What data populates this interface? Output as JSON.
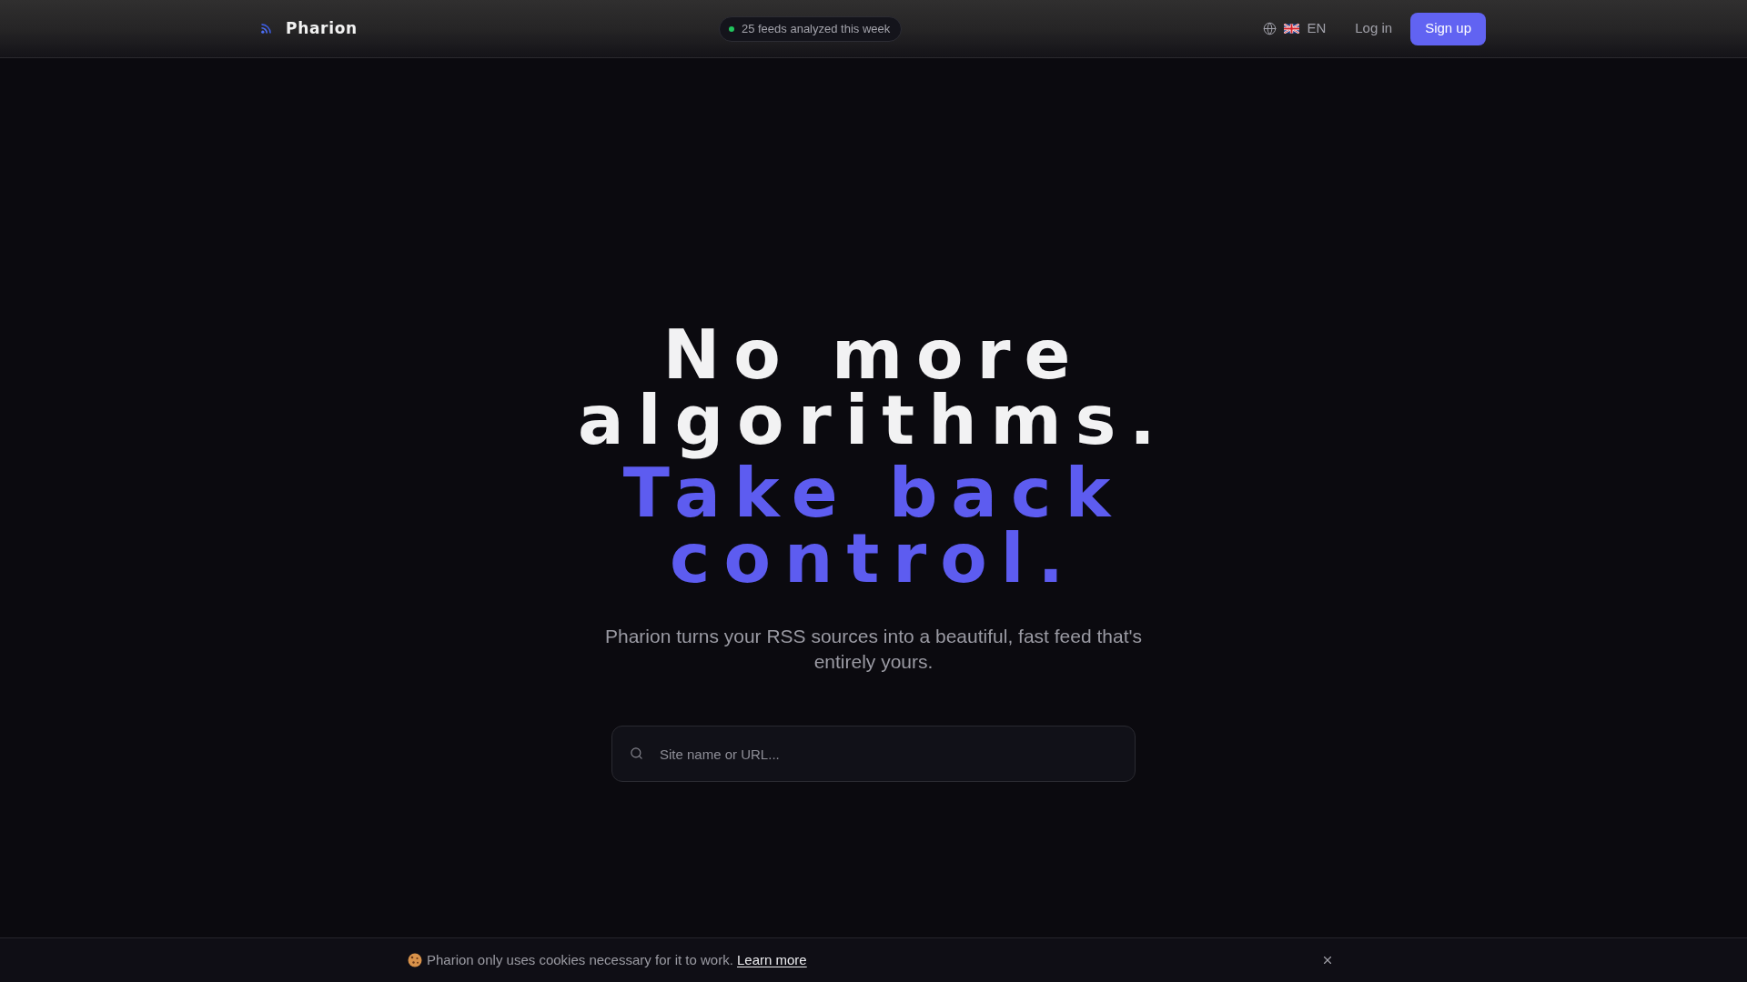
{
  "header": {
    "logo": {
      "name": "Pharion"
    },
    "status_badge": {
      "text": "25 feeds analyzed this week"
    },
    "language": {
      "label": "EN"
    },
    "login": "Log in",
    "signup": "Sign up"
  },
  "hero": {
    "headline": [
      {
        "text": "No more algorithms.",
        "kind": "plain"
      },
      {
        "text": "Take back control.",
        "kind": "accent"
      }
    ],
    "subtitle": "Pharion turns your RSS sources into a beautiful, fast feed that's entirely yours.",
    "search": {
      "placeholder": "Site name or URL..."
    }
  },
  "cookie_banner": {
    "message": "Pharion only uses cookies necessary for it to work.",
    "link": "Learn more"
  }
}
